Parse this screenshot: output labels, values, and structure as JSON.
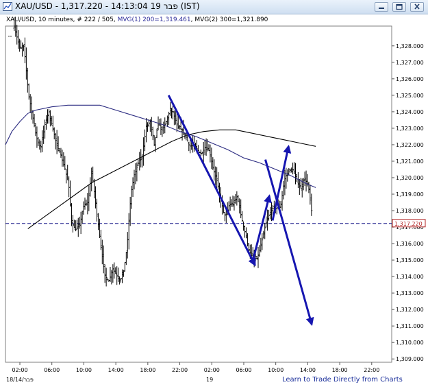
{
  "window": {
    "title": "XAU/USD - 1,317.220 - 14:13:04  פבר 19  (IST)"
  },
  "chart_header": {
    "symbol": "XAU/USD",
    "details": ", 10 minutes, # 222 / 505, ",
    "ma1": "MVG(1) 200=1,319.461",
    "ma2": ", MVG(2) 300=1,321.890"
  },
  "footer": {
    "date_left": "18/14/פבר",
    "date_mid": "19",
    "link": "Learn to Trade Directly from Charts"
  },
  "colors": {
    "candles": "#000000",
    "ma1": "#2a2a80",
    "ma2": "#000000",
    "arrows": "#1616b0",
    "price_line": "#1c1c8c",
    "price_tag": "#b02020"
  },
  "chart_data": {
    "type": "ohlc",
    "title": "XAU/USD",
    "timeframe": "10 minutes",
    "y_ticks": [
      "1,309.000",
      "1,310.000",
      "1,311.000",
      "1,312.000",
      "1,313.000",
      "1,314.000",
      "1,315.000",
      "1,316.000",
      "1,317.000",
      "1,318.000",
      "1,319.000",
      "1,320.000",
      "1,321.000",
      "1,322.000",
      "1,323.000",
      "1,324.000",
      "1,325.000",
      "1,326.000",
      "1,327.000",
      "1,328.000"
    ],
    "y_range": [
      1308.8,
      1329.2
    ],
    "x_tick_labels": [
      "02:00",
      "06:00",
      "10:00",
      "14:00",
      "18:00",
      "22:00",
      "02:00",
      "06:00",
      "10:00",
      "14:00",
      "18:00",
      "22:00"
    ],
    "x_tick_hours": [
      2,
      6,
      10,
      14,
      18,
      22,
      26,
      30,
      34,
      38,
      42,
      46
    ],
    "x_range_hours": [
      0.2,
      48.5
    ],
    "current_price": 1317.22,
    "current_price_label": "1,317.220",
    "price_path": [
      [
        1.3,
        1329.2
      ],
      [
        2.0,
        1327.8
      ],
      [
        2.5,
        1328.0
      ],
      [
        3.1,
        1325.0
      ],
      [
        3.6,
        1323.7
      ],
      [
        4.1,
        1322.4
      ],
      [
        4.6,
        1321.8
      ],
      [
        5.2,
        1323.4
      ],
      [
        5.6,
        1324.0
      ],
      [
        6.1,
        1323.0
      ],
      [
        6.6,
        1322.0
      ],
      [
        7.1,
        1321.4
      ],
      [
        7.6,
        1320.6
      ],
      [
        8.1,
        1319.6
      ],
      [
        8.5,
        1317.2
      ],
      [
        9.0,
        1316.8
      ],
      [
        9.5,
        1317.2
      ],
      [
        10.0,
        1318.3
      ],
      [
        10.5,
        1318.5
      ],
      [
        11.0,
        1320.4
      ],
      [
        11.5,
        1318.3
      ],
      [
        12.1,
        1316.0
      ],
      [
        12.6,
        1314.1
      ],
      [
        13.1,
        1313.7
      ],
      [
        13.6,
        1314.5
      ],
      [
        14.1,
        1314.1
      ],
      [
        14.6,
        1313.8
      ],
      [
        15.0,
        1314.4
      ],
      [
        15.4,
        1315.8
      ],
      [
        15.9,
        1319.1
      ],
      [
        16.3,
        1320.1
      ],
      [
        16.8,
        1320.9
      ],
      [
        17.3,
        1321.3
      ],
      [
        17.8,
        1323.1
      ],
      [
        18.3,
        1323.4
      ],
      [
        18.8,
        1322.0
      ],
      [
        19.3,
        1323.3
      ],
      [
        19.8,
        1322.9
      ],
      [
        20.3,
        1323.4
      ],
      [
        20.8,
        1324.1
      ],
      [
        21.2,
        1323.9
      ],
      [
        21.7,
        1323.1
      ],
      [
        22.2,
        1322.9
      ],
      [
        22.7,
        1322.6
      ],
      [
        23.2,
        1321.9
      ],
      [
        23.7,
        1322.0
      ],
      [
        24.2,
        1321.7
      ],
      [
        24.7,
        1321.4
      ],
      [
        25.2,
        1321.9
      ],
      [
        25.7,
        1321.6
      ],
      [
        26.2,
        1320.5
      ],
      [
        26.7,
        1319.7
      ],
      [
        27.2,
        1318.4
      ],
      [
        27.7,
        1317.6
      ],
      [
        28.2,
        1318.4
      ],
      [
        28.7,
        1318.4
      ],
      [
        29.2,
        1318.9
      ],
      [
        29.7,
        1317.6
      ],
      [
        30.2,
        1316.6
      ],
      [
        30.7,
        1315.5
      ],
      [
        31.2,
        1315.1
      ],
      [
        31.7,
        1315.1
      ],
      [
        32.2,
        1316.0
      ],
      [
        32.7,
        1317.1
      ],
      [
        33.2,
        1317.8
      ],
      [
        33.7,
        1318.2
      ],
      [
        34.2,
        1318.1
      ],
      [
        34.6,
        1318.3
      ],
      [
        35.1,
        1319.9
      ],
      [
        35.6,
        1320.4
      ],
      [
        36.1,
        1320.5
      ],
      [
        36.6,
        1319.9
      ],
      [
        37.1,
        1319.3
      ],
      [
        37.6,
        1320.0
      ],
      [
        38.1,
        1319.4
      ],
      [
        38.6,
        1317.5
      ]
    ],
    "moving_averages": [
      {
        "name": "MVG(1) 200",
        "points": [
          [
            0.2,
            1322.0
          ],
          [
            1.0,
            1322.8
          ],
          [
            2.0,
            1323.4
          ],
          [
            3.0,
            1323.9
          ],
          [
            4.0,
            1324.1
          ],
          [
            6.0,
            1324.3
          ],
          [
            8.0,
            1324.4
          ],
          [
            10.0,
            1324.4
          ],
          [
            12.0,
            1324.4
          ],
          [
            14.0,
            1324.1
          ],
          [
            16.0,
            1323.8
          ],
          [
            18.0,
            1323.5
          ],
          [
            20.0,
            1323.2
          ],
          [
            22.0,
            1322.8
          ],
          [
            24.0,
            1322.5
          ],
          [
            26.0,
            1322.1
          ],
          [
            28.0,
            1321.7
          ],
          [
            30.0,
            1321.2
          ],
          [
            32.0,
            1320.9
          ],
          [
            34.0,
            1320.5
          ],
          [
            36.0,
            1320.1
          ],
          [
            38.0,
            1319.6
          ],
          [
            39.0,
            1319.4
          ]
        ]
      },
      {
        "name": "MVG(2) 300",
        "points": [
          [
            3.0,
            1316.9
          ],
          [
            5.0,
            1317.6
          ],
          [
            7.0,
            1318.3
          ],
          [
            9.0,
            1319.0
          ],
          [
            11.0,
            1319.7
          ],
          [
            13.0,
            1320.2
          ],
          [
            15.0,
            1320.7
          ],
          [
            17.0,
            1321.2
          ],
          [
            19.0,
            1321.7
          ],
          [
            21.0,
            1322.2
          ],
          [
            23.0,
            1322.6
          ],
          [
            25.0,
            1322.8
          ],
          [
            27.0,
            1322.9
          ],
          [
            29.0,
            1322.9
          ],
          [
            31.0,
            1322.7
          ],
          [
            33.0,
            1322.5
          ],
          [
            35.0,
            1322.3
          ],
          [
            37.0,
            1322.1
          ],
          [
            39.0,
            1321.9
          ]
        ]
      }
    ],
    "annotations": [
      {
        "type": "arrow",
        "from": [
          20.6,
          1325.0
        ],
        "to": [
          31.4,
          1314.7
        ]
      },
      {
        "type": "arrow",
        "from": [
          31.1,
          1314.9
        ],
        "to": [
          33.2,
          1318.9
        ]
      },
      {
        "type": "arrow",
        "from": [
          32.7,
          1321.1
        ],
        "to": [
          38.5,
          1311.1
        ]
      },
      {
        "type": "arrow",
        "from": [
          33.6,
          1317.4
        ],
        "to": [
          35.6,
          1321.9
        ]
      }
    ]
  }
}
